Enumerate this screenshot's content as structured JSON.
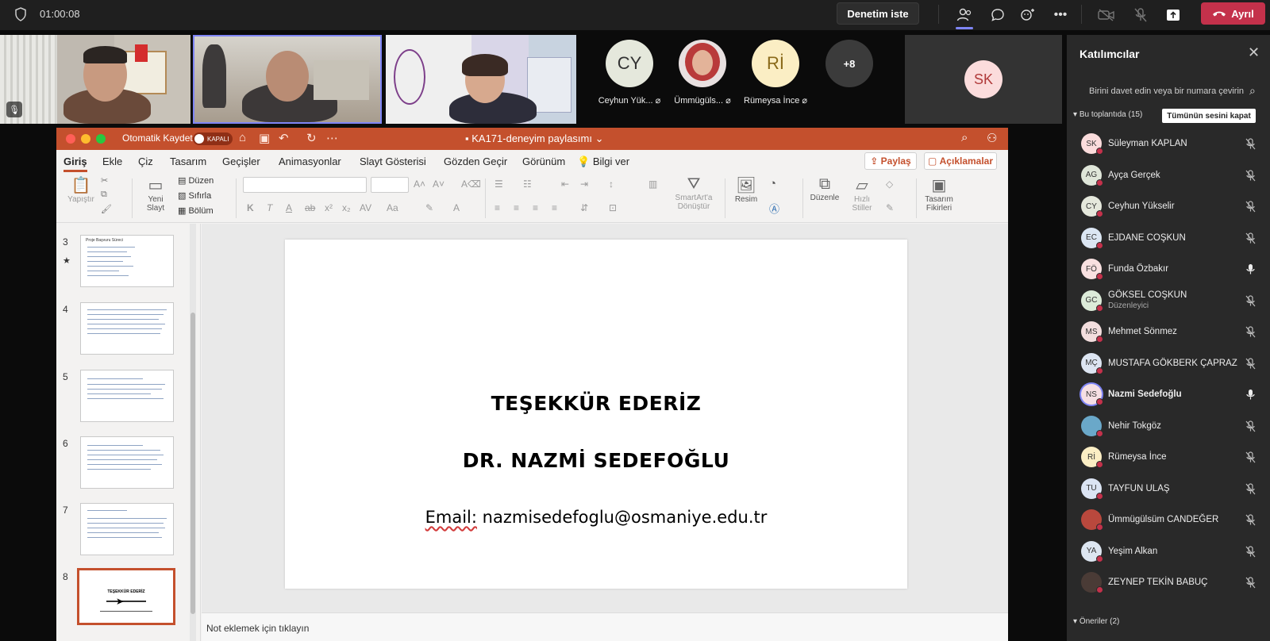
{
  "meeting": {
    "timer": "01:00:08",
    "request_control": "Denetim iste",
    "leave": "Ayrıl",
    "leave_icon": "phone-hangup-icon"
  },
  "toolbar_icons": [
    "people-icon",
    "chat-icon",
    "reactions-icon",
    "more-icon",
    "camera-off-icon",
    "mic-off-icon",
    "share-icon"
  ],
  "video_strip": {
    "avatars": [
      {
        "initials": "CY",
        "name": "Ceyhun Yük...",
        "color": "#e5e8dc"
      },
      {
        "initials": "",
        "name": "Ümmügüls...",
        "color": "#e8e0e0"
      },
      {
        "initials": "Rİ",
        "name": "Rümeysa İnce",
        "color": "#fbeec4"
      }
    ],
    "more_count": "+8",
    "sk_initials": "SK"
  },
  "ppt": {
    "autosave": "Otomatik Kaydet",
    "autosave_state": "KAPALI",
    "doc_title": "KA171-deneyim paylasımı",
    "tabs": [
      "Giriş",
      "Ekle",
      "Çiz",
      "Tasarım",
      "Geçişler",
      "Animasyonlar",
      "Slayt Gösterisi",
      "Gözden Geçir",
      "Görünüm"
    ],
    "tell_me": "Bilgi ver",
    "share": "Paylaş",
    "comments": "Açıklamalar",
    "ribbon": {
      "paste": "Yapıştır",
      "new_slide_1": "Yeni",
      "new_slide_2": "Slayt",
      "layout": "Düzen",
      "reset": "Sıfırla",
      "section": "Bölüm",
      "smartart_1": "SmartArt'a",
      "smartart_2": "Dönüştür",
      "picture": "Resim",
      "arrange": "Düzenle",
      "quick_1": "Hızlı",
      "quick_2": "Stiller",
      "designer_1": "Tasarım",
      "designer_2": "Fikirleri"
    },
    "thumbnails": [
      {
        "num": "3",
        "title": "Proje Başvuru Süreci"
      },
      {
        "num": "4",
        "title": ""
      },
      {
        "num": "5",
        "title": ""
      },
      {
        "num": "6",
        "title": ""
      },
      {
        "num": "7",
        "title": ""
      },
      {
        "num": "8",
        "title": "TEŞEKKÜR EDERİZ"
      }
    ],
    "slide": {
      "line1": "TEŞEKKÜR EDERİZ",
      "line2": "DR. NAZMİ SEDEFOĞLU",
      "email_label": "Email:",
      "email": "nazmisedefoglu@osmaniye.edu.tr"
    },
    "notes_placeholder": "Not eklemek için tıklayın"
  },
  "panel": {
    "title": "Katılımcılar",
    "invite_placeholder": "Birini davet edin veya bir numara çevirin",
    "in_meeting": "Bu toplantıda (15)",
    "mute_all": "Tümünün sesini kapat",
    "suggestions": "Öneriler (2)",
    "participants": [
      {
        "initials": "SK",
        "name": "Süleyman KAPLAN",
        "role": "",
        "color": "#fbdcdc",
        "mic": "mic-off-icon",
        "bold": false
      },
      {
        "initials": "AG",
        "name": "Ayça Gerçek",
        "role": "",
        "color": "#dfe6d9",
        "mic": "mic-off-icon",
        "bold": false
      },
      {
        "initials": "CY",
        "name": "Ceyhun Yükselir",
        "role": "",
        "color": "#e5e8dc",
        "mic": "mic-off-icon",
        "bold": false
      },
      {
        "initials": "EC",
        "name": "EJDANE COŞKUN",
        "role": "",
        "color": "#dbe6f3",
        "mic": "mic-off-icon",
        "bold": false
      },
      {
        "initials": "FÖ",
        "name": "Funda Özbakır",
        "role": "",
        "color": "#f8e0e0",
        "mic": "mic-on-icon",
        "bold": false
      },
      {
        "initials": "GC",
        "name": "GÖKSEL COŞKUN",
        "role": "Düzenleyici",
        "color": "#dcebd9",
        "mic": "mic-off-icon",
        "bold": false
      },
      {
        "initials": "MS",
        "name": "Mehmet Sönmez",
        "role": "",
        "color": "#f3dede",
        "mic": "mic-off-icon",
        "bold": false
      },
      {
        "initials": "MÇ",
        "name": "MUSTAFA GÖKBERK ÇAPRAZ",
        "role": "",
        "color": "#dde5f2",
        "mic": "mic-off-icon",
        "bold": false
      },
      {
        "initials": "NS",
        "name": "Nazmi Sedefoğlu",
        "role": "",
        "color": "#f6dfe4",
        "mic": "mic-on-icon",
        "bold": true
      },
      {
        "initials": "",
        "name": "Nehir Tokgöz",
        "role": "",
        "color": "#6aa8c9",
        "mic": "mic-off-icon",
        "bold": false
      },
      {
        "initials": "Rİ",
        "name": "Rümeysa İnce",
        "role": "",
        "color": "#fbeec4",
        "mic": "mic-off-icon",
        "bold": false
      },
      {
        "initials": "TU",
        "name": "TAYFUN ULAŞ",
        "role": "",
        "color": "#dbe4f3",
        "mic": "mic-off-icon",
        "bold": false
      },
      {
        "initials": "",
        "name": "Ümmügülsüm CANDEĞER",
        "role": "",
        "color": "#b9483d",
        "mic": "mic-off-icon",
        "bold": false
      },
      {
        "initials": "YA",
        "name": "Yeşim Alkan",
        "role": "",
        "color": "#dde6f1",
        "mic": "mic-off-icon",
        "bold": false
      },
      {
        "initials": "",
        "name": "ZEYNEP TEKİN BABUÇ",
        "role": "",
        "color": "#4a3b36",
        "mic": "mic-off-icon",
        "bold": false
      }
    ]
  }
}
